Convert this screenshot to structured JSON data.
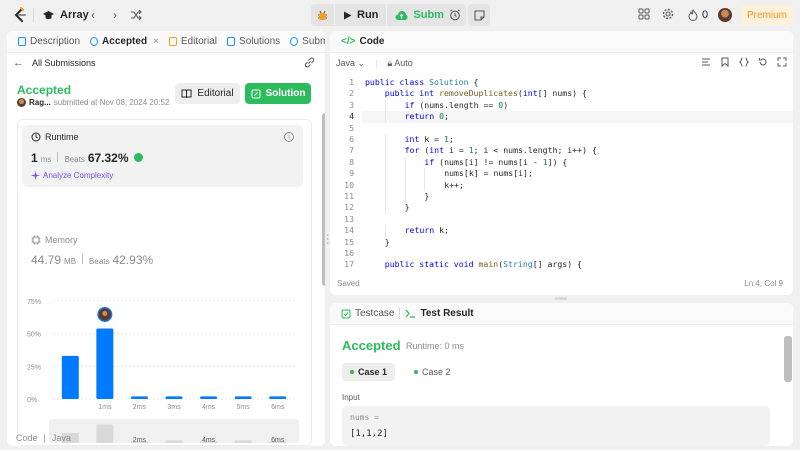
{
  "topbar": {
    "problem_list": "Array",
    "run_label": "Run",
    "submit_label": "Submit",
    "streak_count": "0",
    "premium_label": "Premium"
  },
  "left_tabs": [
    {
      "label": "Description",
      "icon": "description-icon"
    },
    {
      "label": "Accepted",
      "icon": "history-icon",
      "active": true
    },
    {
      "label": "Editorial",
      "icon": "editorial-icon"
    },
    {
      "label": "Solutions",
      "icon": "flask-icon"
    },
    {
      "label": "Submissi",
      "icon": "history-icon"
    }
  ],
  "submission": {
    "back_label": "All Submissions",
    "status": "Accepted",
    "user": "Rag...",
    "submitted_text": "submitted at Nov 08, 2024 20:52",
    "editorial_button": "Editorial",
    "solution_button": "Solution"
  },
  "runtime": {
    "label": "Runtime",
    "value": "1",
    "unit": "ms",
    "beats_label": "Beats",
    "beats_value": "67.32%",
    "analyze_label": "Analyze Complexity"
  },
  "memory": {
    "label": "Memory",
    "value": "44.79",
    "unit": "MB",
    "beats_label": "Beats",
    "beats_value": "42.93%"
  },
  "chart_data": {
    "type": "bar",
    "ytick_labels": [
      "75%",
      "50%",
      "25%",
      "0%"
    ],
    "yticks": [
      75,
      50,
      25,
      0
    ],
    "ylim": [
      0,
      75
    ],
    "categories": [
      "",
      "1ms",
      "2ms",
      "3ms",
      "4ms",
      "5ms",
      "6ms"
    ],
    "values": [
      33,
      54,
      2,
      2,
      2,
      2,
      2
    ],
    "highlight_index": 1,
    "bar_color": "#007aff",
    "mini_labels": [
      "",
      "",
      "2ms",
      "",
      "4ms",
      "",
      "6ms"
    ],
    "mini_values": [
      30,
      55,
      5,
      8,
      5,
      8,
      5
    ]
  },
  "code_footer": {
    "label": "Code",
    "lang": "Java"
  },
  "code_panel": {
    "title": "Code",
    "language": "Java",
    "mode": "Auto",
    "saved": "Saved",
    "cursor": "Ln 4, Col 9",
    "current_line": 4,
    "lines": [
      {
        "n": "1",
        "indent": 0,
        "html": "<span class=\"kw\">public class</span> <span class=\"ty\">Solution</span> {"
      },
      {
        "n": "2",
        "indent": 1,
        "html": "<span class=\"kw\">public int</span> <span class=\"fn\">removeDuplicates</span>(<span class=\"kw\">int</span>[] nums) {"
      },
      {
        "n": "3",
        "indent": 2,
        "html": "<span class=\"kw\">if</span> (nums.length == <span class=\"nm\">0</span>)"
      },
      {
        "n": "4",
        "indent": 2,
        "html": "<span class=\"kw\">return</span> <span class=\"nm\">0</span>;"
      },
      {
        "n": "5",
        "indent": 0,
        "html": ""
      },
      {
        "n": "6",
        "indent": 2,
        "html": "<span class=\"kw\">int</span> k = <span class=\"nm\">1</span>;"
      },
      {
        "n": "7",
        "indent": 2,
        "html": "<span class=\"kw\">for</span> (<span class=\"kw\">int</span> i = <span class=\"nm\">1</span>; i &lt; nums.length; i++) {"
      },
      {
        "n": "8",
        "indent": 3,
        "html": "<span class=\"kw\">if</span> (nums[i] != nums[i - <span class=\"nm\">1</span>]) {"
      },
      {
        "n": "9",
        "indent": 4,
        "html": "nums[k] = nums[i];"
      },
      {
        "n": "10",
        "indent": 4,
        "html": "k++;"
      },
      {
        "n": "11",
        "indent": 3,
        "html": "}"
      },
      {
        "n": "12",
        "indent": 2,
        "html": "}"
      },
      {
        "n": "13",
        "indent": 0,
        "html": ""
      },
      {
        "n": "14",
        "indent": 2,
        "html": "<span class=\"kw\">return</span> k;"
      },
      {
        "n": "15",
        "indent": 1,
        "html": "}"
      },
      {
        "n": "16",
        "indent": 0,
        "html": ""
      },
      {
        "n": "17",
        "indent": 1,
        "html": "<span class=\"kw\">public static void</span> <span class=\"fn\">main</span>(<span class=\"ty\">String</span>[] args) {"
      }
    ]
  },
  "test_panel": {
    "testcase_tab": "Testcase",
    "result_tab": "Test Result",
    "status": "Accepted",
    "runtime_text": "Runtime: 0 ms",
    "case1": "Case 1",
    "case2": "Case 2",
    "input_label": "Input",
    "input_name": "nums =",
    "input_value": "[1,1,2]"
  },
  "colors": {
    "accent_green": "#2cbb5d",
    "bar_blue": "#007aff",
    "premium_orange": "#e99a1c",
    "analyze_purple": "#7b52e8"
  }
}
